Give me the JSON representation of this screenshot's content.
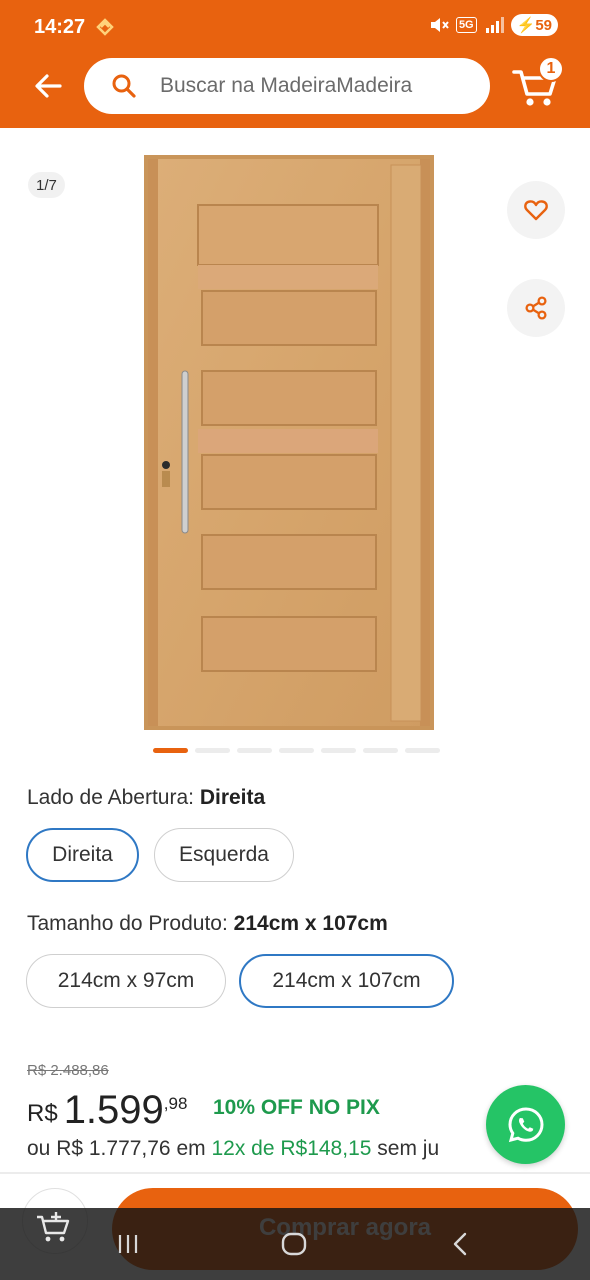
{
  "status_bar": {
    "time": "14:27",
    "network": "5G",
    "battery": "59"
  },
  "header": {
    "search_placeholder": "Buscar na MadeiraMadeira",
    "cart_count": "1"
  },
  "gallery": {
    "counter": "1/7",
    "total_images": 7,
    "active_index": 0
  },
  "options": {
    "opening": {
      "label": "Lado de Abertura:",
      "selected": "Direita",
      "choices": [
        "Direita",
        "Esquerda"
      ]
    },
    "size": {
      "label": "Tamanho do Produto:",
      "selected": "214cm x 107cm",
      "choices": [
        "214cm x 97cm",
        "214cm x 107cm"
      ]
    }
  },
  "price": {
    "old": "R$ 2.488,86",
    "currency": "R$",
    "integer": "1.599",
    "cents": ",98",
    "pix": "10% OFF NO PIX",
    "installments_prefix": "ou R$ 1.777,76 em",
    "installments_highlight": "12x de R$148,15",
    "installments_suffix": "sem ju"
  },
  "actions": {
    "buy_label": "Comprar agora"
  },
  "colors": {
    "brand": "#e8620f",
    "selected_border": "#2f78c4",
    "pix_green": "#1e9a4d",
    "whatsapp": "#25c466"
  }
}
